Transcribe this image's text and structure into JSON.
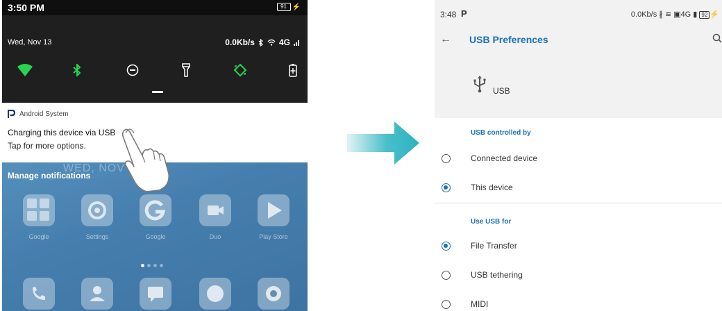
{
  "left_phone": {
    "status_time": "3:50 PM",
    "battery_level": "91",
    "date": "Wed, Nov 13",
    "network_status": "0.0Kb/s",
    "network_type": "4G",
    "quick_settings": [
      "wifi-icon",
      "bluetooth-icon",
      "do-not-disturb-icon",
      "flashlight-icon",
      "auto-rotate-icon",
      "battery-saver-icon"
    ],
    "notification": {
      "app_name": "Android System",
      "title": "Charging this device via USB",
      "subtitle": "Tap for more options."
    },
    "home": {
      "lock_date": "WED, NOV 13",
      "manage_label": "Manage notifications",
      "apps_row1": [
        "Google",
        "Settings",
        "Google",
        "Duo",
        "Play Store"
      ]
    }
  },
  "right_phone": {
    "status_time": "3:48",
    "status_icon_letter": "P",
    "network_status": "0.0Kb/s",
    "network_type": "4G",
    "battery_level": "92",
    "title": "USB Preferences",
    "usb_label": "USB",
    "section_controlled": "USB controlled by",
    "controlled_options": [
      {
        "label": "Connected device",
        "selected": false
      },
      {
        "label": "This device",
        "selected": true
      }
    ],
    "section_use": "Use USB for",
    "use_options": [
      {
        "label": "File Transfer",
        "selected": true
      },
      {
        "label": "USB tethering",
        "selected": false
      },
      {
        "label": "MIDI",
        "selected": false
      }
    ]
  },
  "colors": {
    "accent_blue": "#1a73b8",
    "qs_green": "#27d44e",
    "arrow_teal": "#2bb3c0"
  }
}
